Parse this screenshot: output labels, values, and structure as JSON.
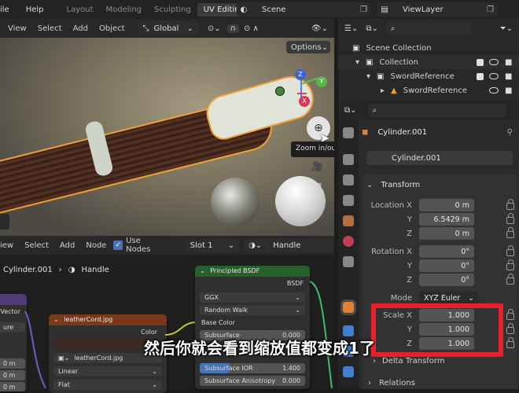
{
  "topbar": {
    "menu_fill": "ile",
    "menu_help": "Help",
    "workspaces": [
      "Layout",
      "Modeling",
      "Sculpting",
      "UV Editing"
    ],
    "scene": "Scene",
    "view_layer": "ViewLayer"
  },
  "viewport": {
    "menus": [
      "View",
      "Select",
      "Add",
      "Object"
    ],
    "orientation": "Global",
    "options": "Options",
    "tooltip": "Zoom in/out in the view",
    "gizmo": {
      "z": "Z",
      "y": "Y",
      "x": "X"
    }
  },
  "outliner": {
    "items": [
      {
        "label": "Scene Collection",
        "level": 0
      },
      {
        "label": "Collection",
        "level": 1
      },
      {
        "label": "SwordReference",
        "level": 2
      },
      {
        "label": "SwordReference",
        "level": 3
      }
    ]
  },
  "properties": {
    "object_name": "Cylinder.001",
    "data_name": "Cylinder.001",
    "panel_title": "Transform",
    "location": {
      "label": "Location",
      "x": "0 m",
      "y": "6.5429 m",
      "z": "0 m"
    },
    "rotation": {
      "label": "Rotation",
      "x": "0°",
      "y": "0°",
      "z": "0°"
    },
    "mode": {
      "label": "Mode",
      "value": "XYZ Euler"
    },
    "scale": {
      "label": "Scale",
      "x": "1.000",
      "y": "1.000",
      "z": "1.000"
    },
    "axis_labels": {
      "x": "X",
      "y": "Y",
      "z": "Z"
    },
    "delta_transform": "Delta Transform",
    "relations": "Relations"
  },
  "node_editor": {
    "menus": [
      "iew",
      "Select",
      "Add",
      "Node"
    ],
    "use_nodes": "Use Nodes",
    "slot": "Slot 1",
    "material": "Handle",
    "breadcrumb_object": "Cylinder.001",
    "breadcrumb_material": "Handle"
  },
  "nodes": {
    "principled": {
      "title": "Principled BSDF",
      "output": "BSDF",
      "distribution": "GGX",
      "subsurface_method": "Random Walk",
      "base_color": "Base Color",
      "subsurface": "Subsurface",
      "subsurface_value": "0.000",
      "subsurface_ior": "Subsurface IOR",
      "subsurface_ior_value": "1.400",
      "subsurface_anisotropy": "Subsurface Anisotropy",
      "subsurface_anisotropy_value": "0.000"
    },
    "image": {
      "title": "leatherCord.jpg",
      "output": "Color",
      "image_name": "leatherCord.jpg",
      "interpolation": "Linear",
      "projection": "Flat"
    },
    "left": {
      "output": "Vector",
      "row1": "ure",
      "row2": "0 m",
      "row3": "0 m",
      "row4": "0 m"
    }
  },
  "subtitle": "然后你就会看到缩放值都变成1了",
  "colors": {
    "highlight_box": "#e8202a",
    "selection_outline": "#f0a030",
    "active_blue": "#4772b3",
    "node_header_green": "#26612b",
    "node_header_orange": "#7a3a1a"
  }
}
